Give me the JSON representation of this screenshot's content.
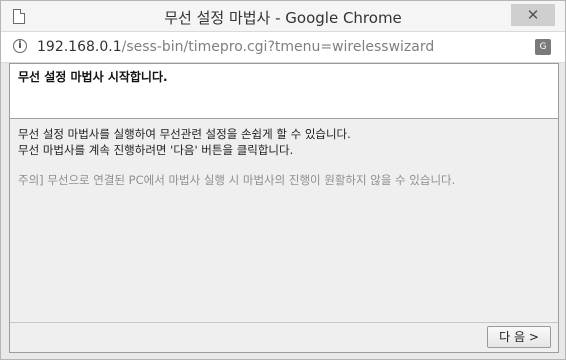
{
  "window": {
    "title": "무선 설정 마법사 - Google Chrome",
    "close_label": "✕"
  },
  "address": {
    "host": "192.168.0.1",
    "path": "/sess-bin/timepro.cgi?tmenu=wirelesswizard",
    "info_glyph": "i",
    "translate_glyph": "G"
  },
  "wizard": {
    "heading": "무선 설정 마법사 시작합니다.",
    "line1": "무선 설정 마법사를 실행하여 무선관련 설정을 손쉽게 할 수 있습니다.",
    "line2": "무선 마법사를 계속 진행하려면 '다음' 버튼을 클릭합니다.",
    "note": "주의] 무선으로 연결된 PC에서 마법사 실행 시 마법사의 진행이 원활하지 않을 수 있습니다.",
    "next_label": "다 음 >"
  },
  "colors": {
    "titlebar": "#f5f5f5",
    "content_bg": "#efefef",
    "note_text": "#8f8f8f"
  }
}
